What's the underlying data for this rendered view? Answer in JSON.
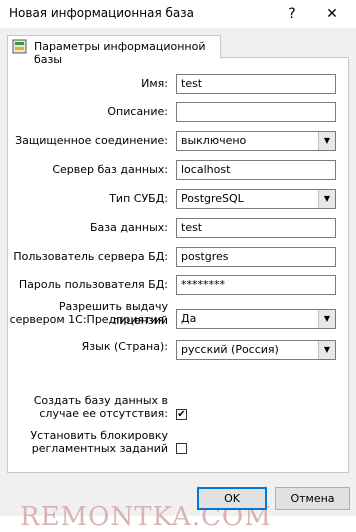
{
  "window": {
    "title": "Новая информационная база",
    "help": "?",
    "close": "✕"
  },
  "tab": {
    "label": "Параметры информационной базы"
  },
  "form": {
    "name_label": "Имя:",
    "name_value": "test",
    "desc_label": "Описание:",
    "desc_value": "",
    "secure_label": "Защищенное соединение:",
    "secure_value": "выключено",
    "server_label": "Сервер баз данных:",
    "server_value": "localhost",
    "dbms_label": "Тип СУБД:",
    "dbms_value": "PostgreSQL",
    "db_label": "База данных:",
    "db_value": "test",
    "user_label": "Пользователь сервера БД:",
    "user_value": "postgres",
    "pass_label": "Пароль пользователя БД:",
    "pass_value": "********",
    "license_label_1": "Разрешить выдачу лицензий",
    "license_label_2": "сервером 1С:Предприятия:",
    "license_value": "Да",
    "lang_label": "Язык (Страна):",
    "lang_value": "русский (Россия)",
    "create_label_1": "Создать базу данных в",
    "create_label_2": "случае ее отсутствия:",
    "create_checked": "✔",
    "lock_label_1": "Установить блокировку",
    "lock_label_2": "регламентных заданий",
    "lock_checked": ""
  },
  "buttons": {
    "ok": "OK",
    "cancel": "Отмена"
  },
  "watermark": "REMONTKA.COM",
  "colors": {
    "accent": "#0078d7",
    "panel": "#ffffff",
    "dialog": "#f0f0f0"
  }
}
